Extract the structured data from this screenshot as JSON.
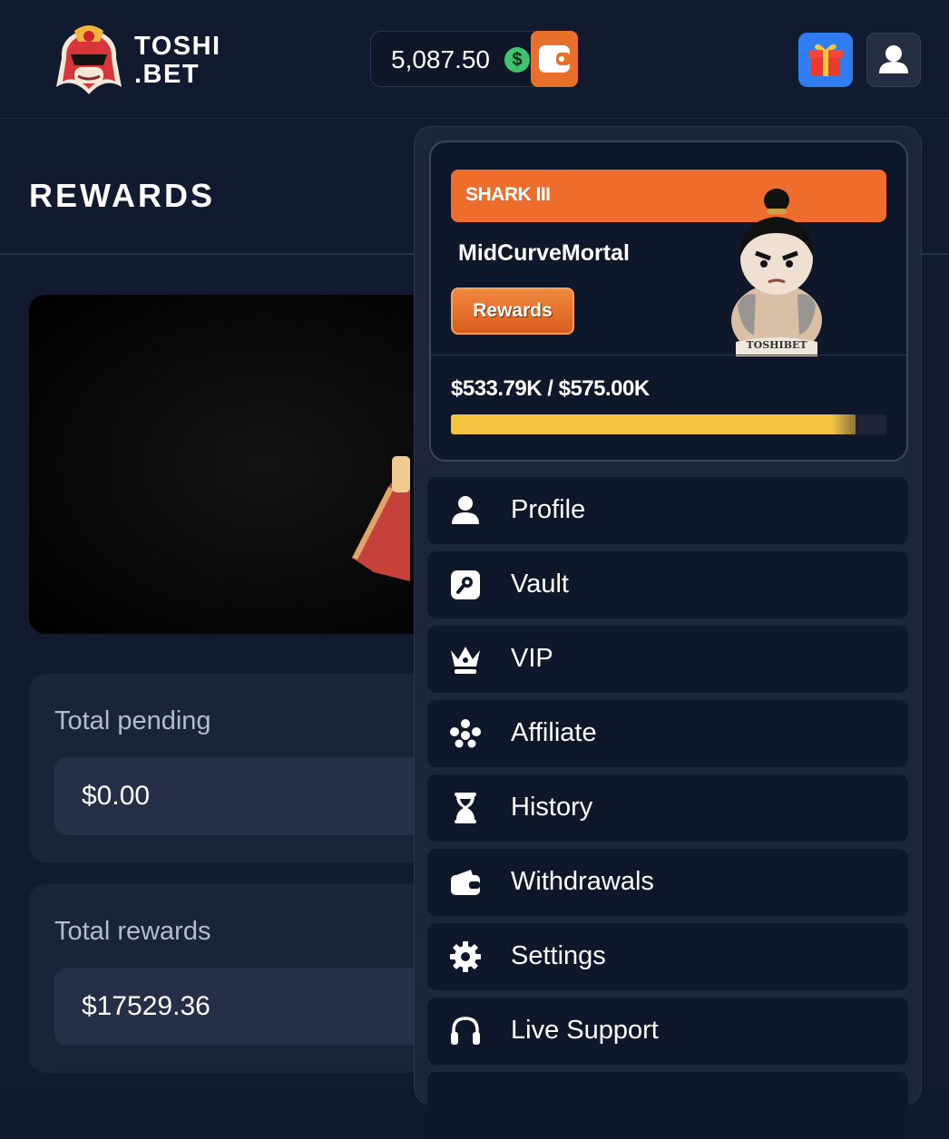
{
  "header": {
    "brand_line1": "TOSHI",
    "brand_line2": ".BET",
    "balance": "5,087.50",
    "currency_symbol": "$"
  },
  "page": {
    "title": "REWARDS",
    "stats": [
      {
        "label": "Total pending",
        "value": "$0.00"
      },
      {
        "label": "Total rewards",
        "value": "$17529.36"
      }
    ]
  },
  "dropdown": {
    "tier": "SHARK III",
    "username": "MidCurveMortal",
    "rewards_button": "Rewards",
    "mascot_text": "TOSHIBET",
    "progress_text": "$533.79K / $575.00K",
    "progress_fraction": 0.9283,
    "menu": [
      {
        "label": "Profile",
        "icon": "user-icon"
      },
      {
        "label": "Vault",
        "icon": "vault-icon"
      },
      {
        "label": "VIP",
        "icon": "crown-icon"
      },
      {
        "label": "Affiliate",
        "icon": "affiliate-icon"
      },
      {
        "label": "History",
        "icon": "hourglass-icon"
      },
      {
        "label": "Withdrawals",
        "icon": "wallet-icon"
      },
      {
        "label": "Settings",
        "icon": "gear-icon"
      },
      {
        "label": "Live Support",
        "icon": "headset-icon"
      }
    ]
  },
  "colors": {
    "accent_orange": "#ee6c2c",
    "progress_yellow": "#f5c542",
    "gift_blue": "#2f7df0",
    "coin_green": "#3ec46d",
    "background": "#111a2e"
  }
}
